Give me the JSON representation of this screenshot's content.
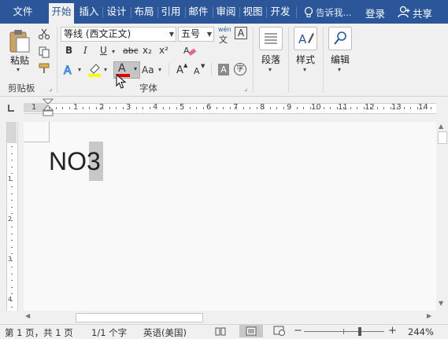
{
  "tabs": [
    {
      "label": "文件"
    },
    {
      "label": "开始"
    },
    {
      "label": "插入"
    },
    {
      "label": "设计"
    },
    {
      "label": "布局"
    },
    {
      "label": "引用"
    },
    {
      "label": "邮件"
    },
    {
      "label": "审阅"
    },
    {
      "label": "视图"
    },
    {
      "label": "开发"
    }
  ],
  "tellme": "告诉我...",
  "login": "登录",
  "share": "共享",
  "clipboard": {
    "paste": "粘贴",
    "group": "剪贴板"
  },
  "font": {
    "name": "等线 (西文正文)",
    "size": "五号",
    "wen": "wén",
    "wen_char": "文",
    "group": "字体",
    "bold": "B",
    "italic": "I",
    "underline": "U",
    "strike": "abc",
    "sub": "x₂",
    "sup": "x²",
    "fontcolor": "A",
    "changecase": "Aa",
    "grow": "A",
    "shrink": "A",
    "shade": "A",
    "encircle": "字"
  },
  "paragraph": {
    "label": "段落"
  },
  "styles": {
    "label": "样式"
  },
  "editing": {
    "label": "编辑"
  },
  "ruler_numbers": [
    "1",
    "1",
    "2",
    "3",
    "4",
    "5",
    "6",
    "7",
    "8",
    "9",
    "10",
    "11",
    "12",
    "13",
    "14"
  ],
  "vruler_numbers": [
    "1",
    "2",
    "3",
    "4"
  ],
  "document": {
    "text": "NO3"
  },
  "status": {
    "page": "第 1 页，共 1 页",
    "words": "1/1 个字",
    "lang": "英语(美国)",
    "zoom": "244%",
    "minus": "−",
    "plus": "+"
  },
  "colors": {
    "accent": "#2b579a",
    "font_red": "#e00000",
    "highlight": "#ffff00"
  }
}
